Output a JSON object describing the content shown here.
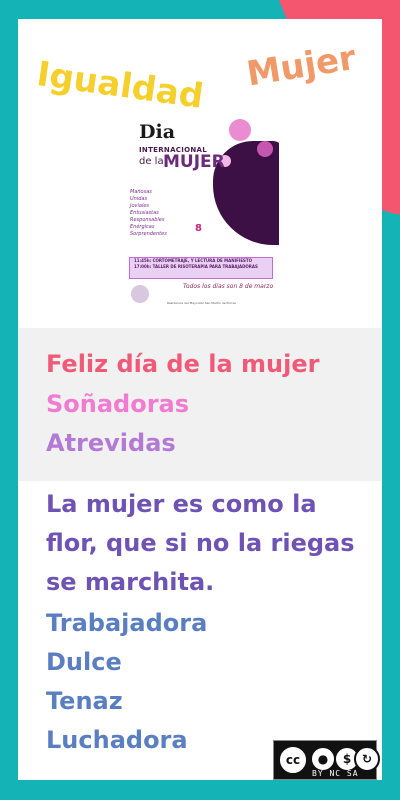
{
  "header": {
    "title_word_1": "Igualdad",
    "title_word_2": "Mujer"
  },
  "poster": {
    "dia": "Dia",
    "internacional": "INTERNACIONAL",
    "de_la": "de la",
    "mujer": "MUJER",
    "words": [
      "Mañosas",
      "Unidas",
      "Joviales",
      "Entusiastas",
      "Responsables",
      "Enérgicas",
      "Sorprendentes"
    ],
    "eight": "8",
    "band_line_1": "11:45h: CORTOMETRAJE, Y LECTURA DE MANIFIESTO",
    "band_line_2": "17:00h: TALLER DE RISOTERAPIA PARA TRABAJADORAS",
    "handwritten": "Todos los días son 8 de marzo",
    "footer_small": "Residencia del Mayorato San Martín de Porres"
  },
  "box": {
    "line_1": "Feliz día de la mujer",
    "line_2": "Soñadoras",
    "line_3": "Atrevidas"
  },
  "quote": "La mujer es como la flor, que si no la riegas se marchita.",
  "list": [
    "Trabajadora",
    "Dulce",
    "Tenaz",
    "Luchadora"
  ],
  "license": {
    "cc": "cc",
    "labels": "BY  NC  SA"
  }
}
